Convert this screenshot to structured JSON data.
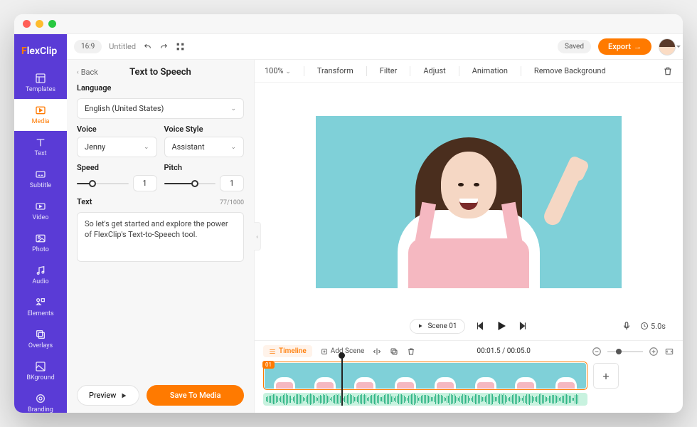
{
  "brand": "FlexClip",
  "topbar": {
    "ratio": "16:9",
    "project_name": "Untitled",
    "saved": "Saved",
    "export": "Export"
  },
  "sidebar": {
    "items": [
      {
        "label": "Templates"
      },
      {
        "label": "Media"
      },
      {
        "label": "Text"
      },
      {
        "label": "Subtitle"
      },
      {
        "label": "Video"
      },
      {
        "label": "Photo"
      },
      {
        "label": "Audio"
      },
      {
        "label": "Elements"
      },
      {
        "label": "Overlays"
      },
      {
        "label": "BKground"
      },
      {
        "label": "Branding"
      }
    ]
  },
  "panel": {
    "back": "Back",
    "title": "Text to Speech",
    "language_label": "Language",
    "language_value": "English (United States)",
    "voice_label": "Voice",
    "voice_value": "Jenny",
    "style_label": "Voice Style",
    "style_value": "Assistant",
    "speed_label": "Speed",
    "speed_value": "1",
    "pitch_label": "Pitch",
    "pitch_value": "1",
    "text_label": "Text",
    "counter": "77/1000",
    "text_value": "So let's get started and explore the power of FlexClip's Text-to-Speech tool.",
    "preview": "Preview",
    "save": "Save To Media"
  },
  "canvasToolbar": {
    "zoom": "100%",
    "transform": "Transform",
    "filter": "Filter",
    "adjust": "Adjust",
    "animation": "Animation",
    "remove_bg": "Remove Background"
  },
  "playback": {
    "scene": "Scene 01",
    "duration": "5.0s"
  },
  "timeline": {
    "label": "Timeline",
    "add_scene": "Add Scene",
    "time": "00:01.5 / 00:05.0",
    "badge": "01"
  }
}
